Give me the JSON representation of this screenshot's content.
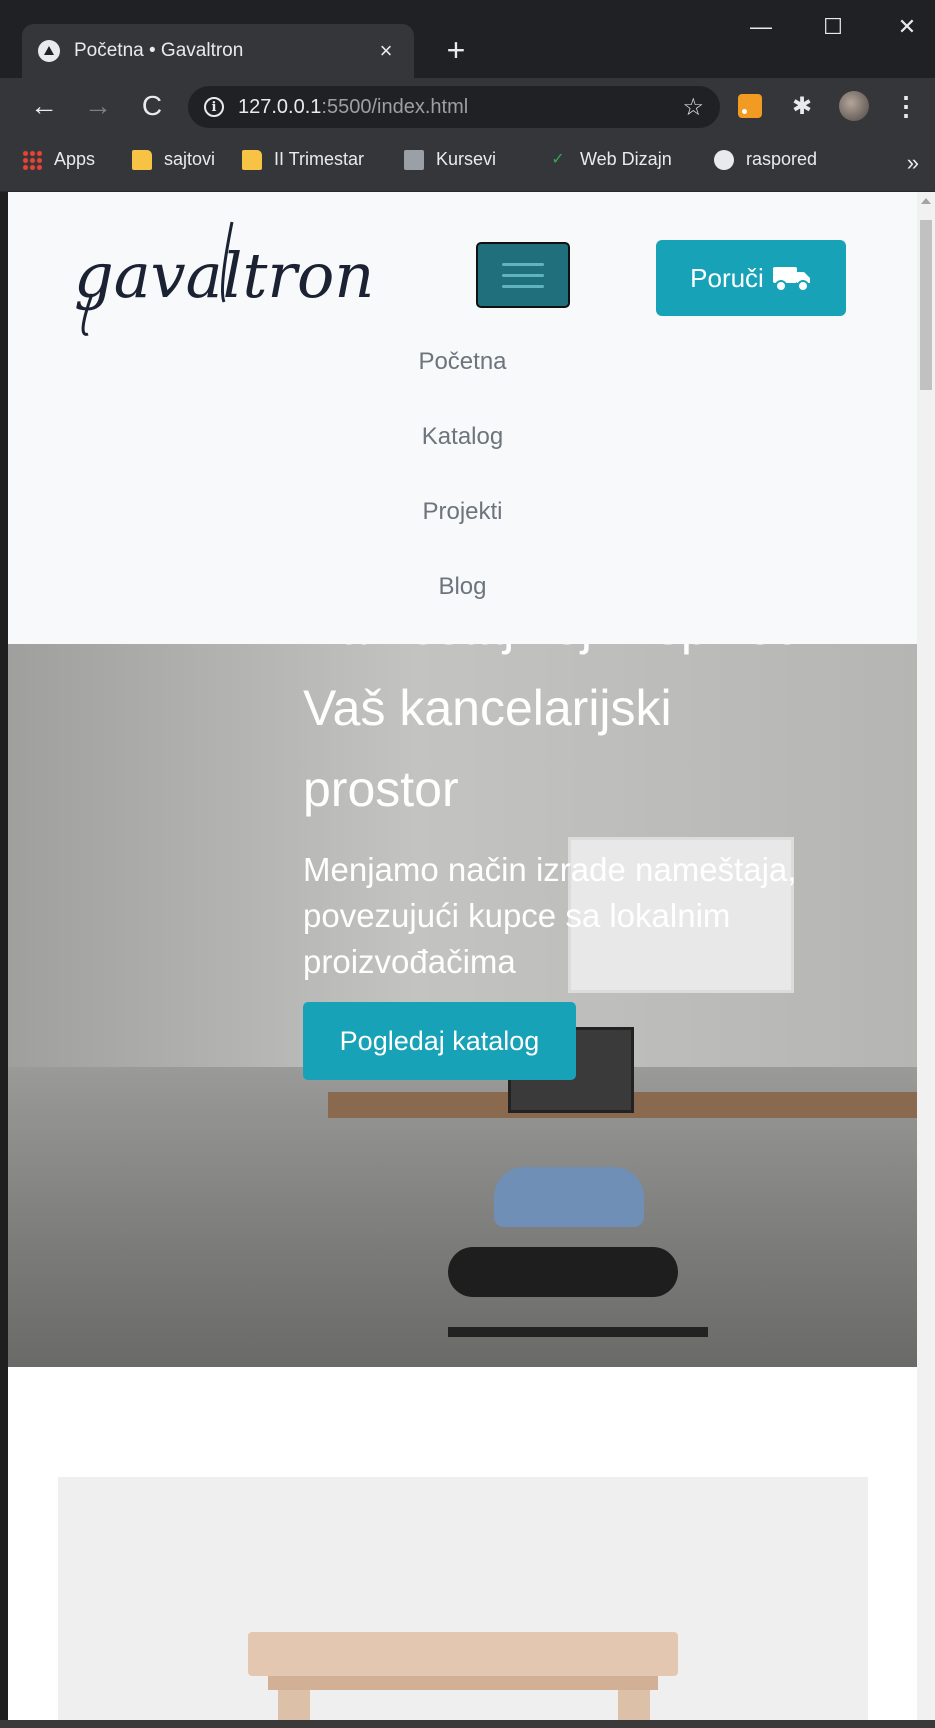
{
  "browser": {
    "tab_title": "Početna • Gavaltron",
    "tab_close": "×",
    "new_tab": "+",
    "window_controls": {
      "minimize": "—",
      "maximize": "☐",
      "close": "✕"
    },
    "nav": {
      "back": "←",
      "forward": "→",
      "reload": "C"
    },
    "url_host": "127.0.0.1",
    "url_rest": ":5500/index.html",
    "bookmarks": [
      {
        "label": "Apps",
        "icon": "apps-grid-icon"
      },
      {
        "label": "sajtovi",
        "icon": "folder-icon"
      },
      {
        "label": "II Trimestar",
        "icon": "folder-icon"
      },
      {
        "label": "Kursevi",
        "icon": "course-icon"
      },
      {
        "label": "Web Dizajn",
        "icon": "web-design-icon"
      },
      {
        "label": "raspored",
        "icon": "globe-icon"
      }
    ],
    "bookmarks_more": "»"
  },
  "navbar": {
    "logo_text": "gavaltron",
    "order_label": "Poruči",
    "menu": [
      "Početna",
      "Katalog",
      "Projekti",
      "Blog"
    ]
  },
  "hero": {
    "title_line_1": "Nameštaj koji inspiriše",
    "title_line_2": "Vaš kancelarijski",
    "title_line_3": "prostor",
    "subtitle": "Menjamo način izrade nameštaja, povezujući kupce sa lokalnim proizvođačima",
    "cta_label": "Pogledaj katalog"
  },
  "colors": {
    "brand_accent": "#17a2b8",
    "toggler": "#1f6f7d",
    "navbar_bg": "#f8f9fa",
    "nav_link": "#6c757d"
  }
}
